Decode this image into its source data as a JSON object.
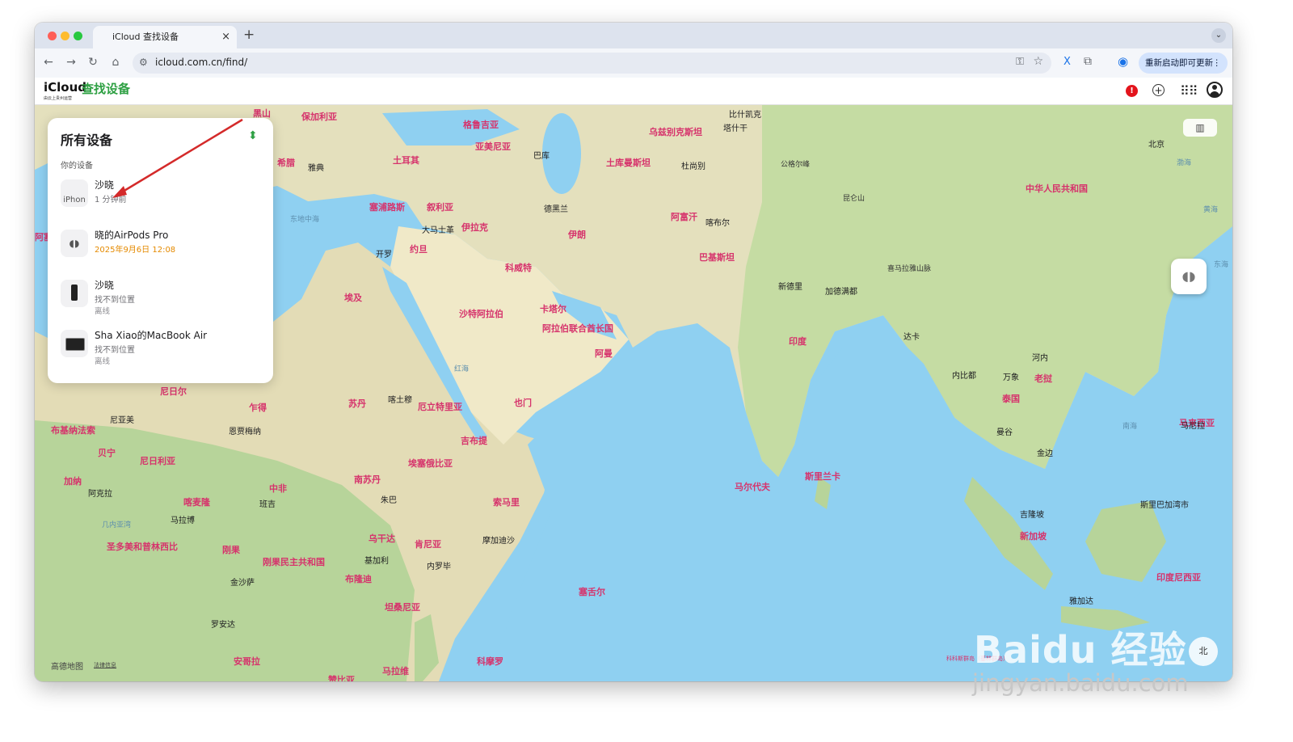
{
  "browser": {
    "tab_title": "iCloud 查找设备",
    "tab_favicon": "apple-icon",
    "new_tab": "+",
    "url": "icloud.com.cn/find/",
    "update_button": "重新启动即可更新",
    "update_more": "⋮",
    "ext_x": "X"
  },
  "header": {
    "brand": "iCloud",
    "app_name": "查找设备",
    "brand_sub": "由云上贵州运营",
    "alert": "!"
  },
  "panel": {
    "title": "所有设备",
    "section_label": "你的设备",
    "devices": [
      {
        "name": "沙晓",
        "status": "1 分钟前",
        "detail": "",
        "thumb": "iPhon"
      },
      {
        "name": "晓的AirPods Pro",
        "status": "2025年9月6日 12:08",
        "detail": "",
        "thumb": ""
      },
      {
        "name": "沙晓",
        "status": "找不到位置",
        "detail": "离线",
        "thumb": ""
      },
      {
        "name": "Sha Xiao的MacBook Air",
        "status": "找不到位置",
        "detail": "离线",
        "thumb": ""
      }
    ]
  },
  "map": {
    "attribution": "高德地图",
    "legal": "法律信息",
    "attribution_right": "科科斯群岛（基林群岛）",
    "compass": "北",
    "labels": {
      "c1": "中华人民共和国",
      "c2": "土库曼斯坦",
      "c3": "乌兹别克斯坦",
      "c4": "阿富汗",
      "c5": "巴基斯坦",
      "c6": "伊朗",
      "c7": "伊拉克",
      "c8": "叙利亚",
      "c9": "塞浦路斯",
      "c10": "土耳其",
      "c11": "希腊",
      "c12": "保加利亚",
      "c13": "格鲁吉亚",
      "c14": "亚美尼亚",
      "c15": "约旦",
      "c16": "科威特",
      "c17": "沙特阿拉伯",
      "c18": "卡塔尔",
      "c19": "阿拉伯联合酋长国",
      "c20": "阿曼",
      "c21": "也门",
      "c22": "埃及",
      "c23": "苏丹",
      "c24": "厄立特里亚",
      "c25": "吉布提",
      "c26": "埃塞俄比亚",
      "c27": "索马里",
      "c28": "南苏丹",
      "c29": "中非",
      "c30": "乍得",
      "c31": "尼日尔",
      "c32": "尼日利亚",
      "c33": "贝宁",
      "c34": "布基纳法索",
      "c35": "加纳",
      "c36": "喀麦隆",
      "c37": "刚果",
      "c38": "刚果民主共和国",
      "c39": "圣多美和普林西比",
      "c40": "乌干达",
      "c41": "肯尼亚",
      "c42": "布隆迪",
      "c43": "坦桑尼亚",
      "c44": "安哥拉",
      "c45": "马拉维",
      "c46": "赞比亚",
      "c47": "科摩罗",
      "c48": "塞舌尔",
      "c49": "马尔代夫",
      "c50": "斯里兰卡",
      "c51": "印度",
      "c52": "泰国",
      "c53": "老挝",
      "c54": "新加坡",
      "c55": "印度尼西亚",
      "c56": "马来西亚",
      "c57": "黑山",
      "c58": "阿塞拜疆",
      "t1": "北京",
      "t2": "比什凯克",
      "t3": "塔什干",
      "t4": "杜尚别",
      "t5": "喀布尔",
      "t6": "新德里",
      "t7": "加德满都",
      "t8": "达卡",
      "t9": "内比都",
      "t10": "河内",
      "t11": "万象",
      "t12": "曼谷",
      "t13": "金边",
      "t14": "吉隆坡",
      "t15": "马尼拉",
      "t16": "斯里巴加湾市",
      "t17": "雅加达",
      "t18": "巴库",
      "t19": "德黑兰",
      "t20": "大马士革",
      "t21": "雅典",
      "t22": "开罗",
      "t23": "喀土穆",
      "t24": "朱巴",
      "t25": "恩贾梅纳",
      "t26": "尼亚美",
      "t27": "阿克拉",
      "t28": "班吉",
      "t29": "马拉博",
      "t30": "基加利",
      "t31": "内罗毕",
      "t32": "摩加迪沙",
      "t33": "金沙萨",
      "t34": "罗安达",
      "s1": "东地中海",
      "s2": "红海",
      "s3": "几内亚湾",
      "s4": "黄海",
      "s5": "渤海",
      "s6": "南海",
      "s7": "东海",
      "p1": "公格尔峰",
      "p2": "昆仑山",
      "p3": "喜马拉雅山脉"
    }
  }
}
